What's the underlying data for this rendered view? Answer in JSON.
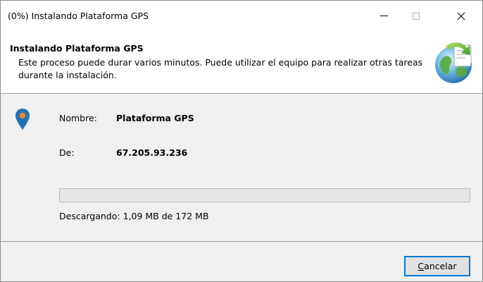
{
  "window": {
    "title": "(0%) Instalando Plataforma GPS",
    "controls": [
      "minimize-icon",
      "maximize-icon",
      "close-icon"
    ],
    "close_glyph": "✕"
  },
  "header": {
    "heading": "Instalando Plataforma GPS",
    "description": "Este proceso puede durar varios minutos. Puede utilizar el equipo para realizar otras tareas durante la instalación.",
    "logo_icon": "globe-installer-icon"
  },
  "details": {
    "pin_icon": "map-pin-icon",
    "name_label": "Nombre:",
    "name_value": "Plataforma GPS",
    "from_label": "De:",
    "from_value": "67.205.93.236"
  },
  "progress": {
    "percent": 0,
    "status_text": "Descargando: 1,09 MB de 172 MB"
  },
  "footer": {
    "cancel_accesskey": "C",
    "cancel_rest": "ancelar"
  },
  "colors": {
    "accent": "#0078d7",
    "pin": "#1f72b8",
    "pin_dot": "#f08a24",
    "progress_fill": "#06b025"
  }
}
